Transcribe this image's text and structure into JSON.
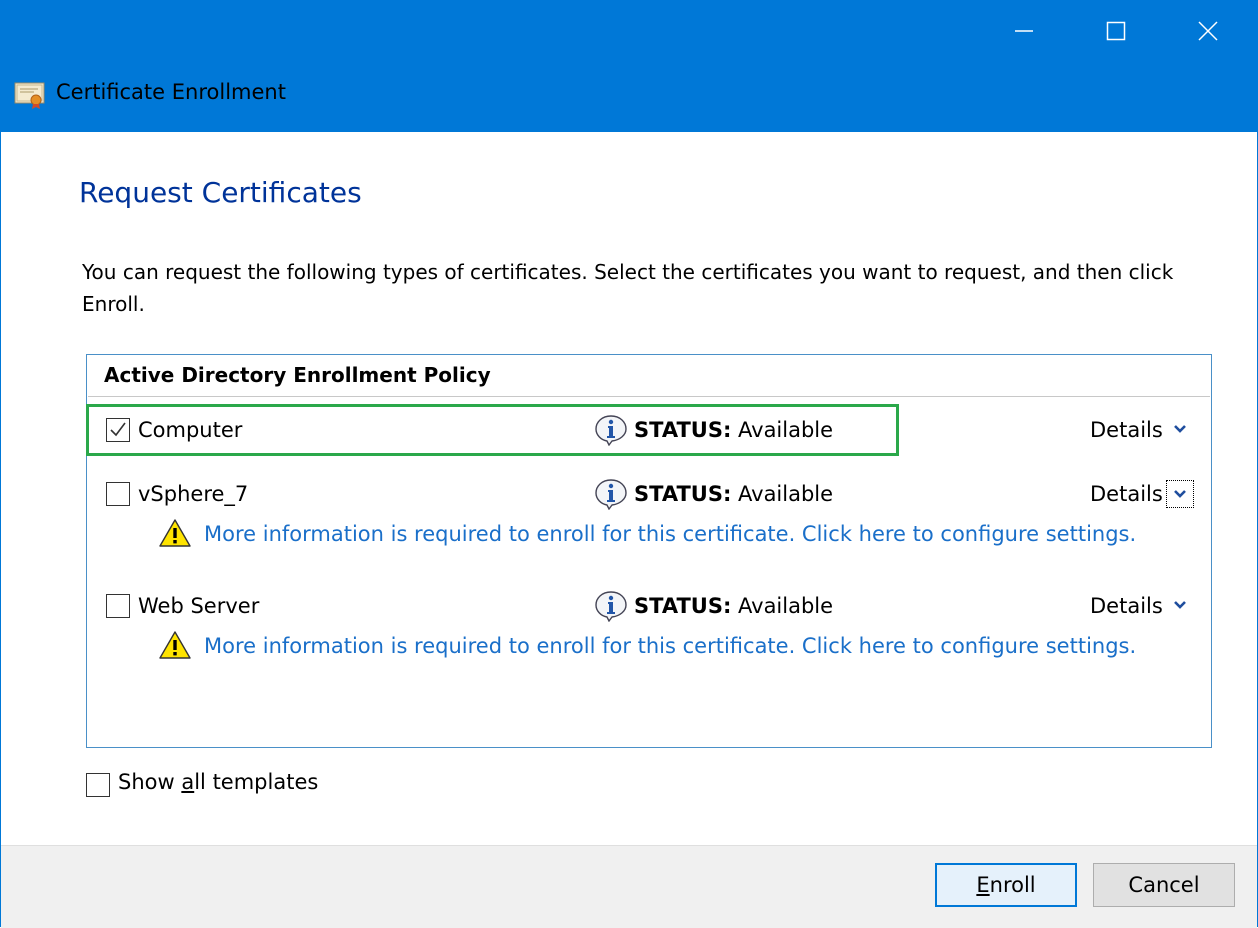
{
  "window": {
    "title": "Certificate Enrollment",
    "accent_color": "#0078d7",
    "controls": [
      "minimize-icon",
      "maximize-icon",
      "close-icon"
    ]
  },
  "page": {
    "title": "Request Certificates",
    "instructions": "You can request the following types of certificates. Select the certificates you want to request, and then click Enroll."
  },
  "policy": {
    "header": "Active Directory Enrollment Policy",
    "items": [
      {
        "name": "Computer",
        "checked": true,
        "status_label": "STATUS:",
        "status_value": "Available",
        "details_label": "Details"
      },
      {
        "name": "vSphere_7",
        "checked": false,
        "status_label": "STATUS:",
        "status_value": "Available",
        "details_label": "Details",
        "warning": "More information is required to enroll for this certificate. Click here to configure settings."
      },
      {
        "name": "Web Server",
        "checked": false,
        "status_label": "STATUS:",
        "status_value": "Available",
        "details_label": "Details",
        "warning": "More information is required to enroll for this certificate. Click here to configure settings."
      }
    ]
  },
  "options": {
    "show_all_templates_prefix": "Show ",
    "show_all_templates_accel": "a",
    "show_all_templates_suffix": "ll templates",
    "show_all_checked": false
  },
  "buttons": {
    "enroll_accel": "E",
    "enroll_rest": "nroll",
    "cancel": "Cancel"
  },
  "colors": {
    "title_blue": "#003399",
    "link_blue": "#1a6fc9",
    "highlight_green": "#2aa84a"
  }
}
